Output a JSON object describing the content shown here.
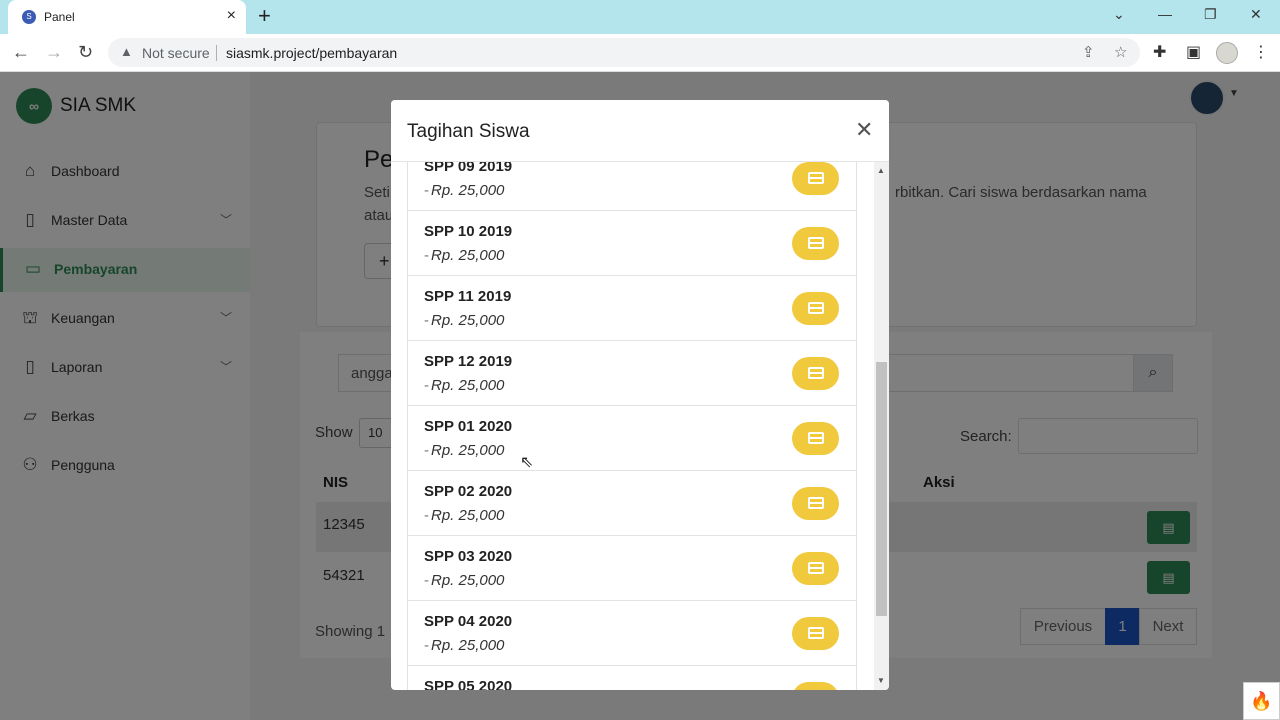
{
  "browser": {
    "tab_title": "Panel",
    "security_text": "Not secure",
    "url": "siasmk.project/pembayaran"
  },
  "app": {
    "brand_name": "SIA SMK",
    "brand_logo_glyph": "∞"
  },
  "sidebar": {
    "items": [
      {
        "label": "Dashboard",
        "icon": "home-icon",
        "expandable": false,
        "active": false
      },
      {
        "label": "Master Data",
        "icon": "database-icon",
        "expandable": true,
        "active": false
      },
      {
        "label": "Pembayaran",
        "icon": "credit-card-icon",
        "expandable": false,
        "active": true
      },
      {
        "label": "Keuangan",
        "icon": "bank-icon",
        "expandable": true,
        "active": false
      },
      {
        "label": "Laporan",
        "icon": "book-icon",
        "expandable": true,
        "active": false
      },
      {
        "label": "Berkas",
        "icon": "folder-icon",
        "expandable": false,
        "active": false
      },
      {
        "label": "Pengguna",
        "icon": "users-icon",
        "expandable": false,
        "active": false
      }
    ]
  },
  "page": {
    "title_partial": "Pe",
    "desc_line1_left": "Seti",
    "desc_line1_right": "rbitkan. Cari siswa berdasarkan nama",
    "desc_line2_left": "atau",
    "add_button_glyph": "+",
    "search_value_partial": "angga",
    "show_label": "Show",
    "show_value": "10",
    "table_search_label": "Search:",
    "columns": {
      "nis": "NIS",
      "aksi": "Aksi"
    },
    "rows": [
      {
        "nis": "12345"
      },
      {
        "nis": "54321"
      }
    ],
    "showing_partial": "Showing 1",
    "pagination": {
      "previous": "Previous",
      "current": "1",
      "next": "Next"
    }
  },
  "modal": {
    "title": "Tagihan Siswa",
    "bills": [
      {
        "name": "SPP 09 2019",
        "amount": "Rp. 25,000"
      },
      {
        "name": "SPP 10 2019",
        "amount": "Rp. 25,000"
      },
      {
        "name": "SPP 11 2019",
        "amount": "Rp. 25,000"
      },
      {
        "name": "SPP 12 2019",
        "amount": "Rp. 25,000"
      },
      {
        "name": "SPP 01 2020",
        "amount": "Rp. 25,000"
      },
      {
        "name": "SPP 02 2020",
        "amount": "Rp. 25,000"
      },
      {
        "name": "SPP 03 2020",
        "amount": "Rp. 25,000"
      },
      {
        "name": "SPP 04 2020",
        "amount": "Rp. 25,000"
      },
      {
        "name": "SPP 05 2020",
        "amount": ""
      }
    ]
  },
  "colors": {
    "brand_green": "#2e8b57",
    "pay_button_yellow": "#f0c93c",
    "pagination_active_blue": "#1a56c4"
  }
}
